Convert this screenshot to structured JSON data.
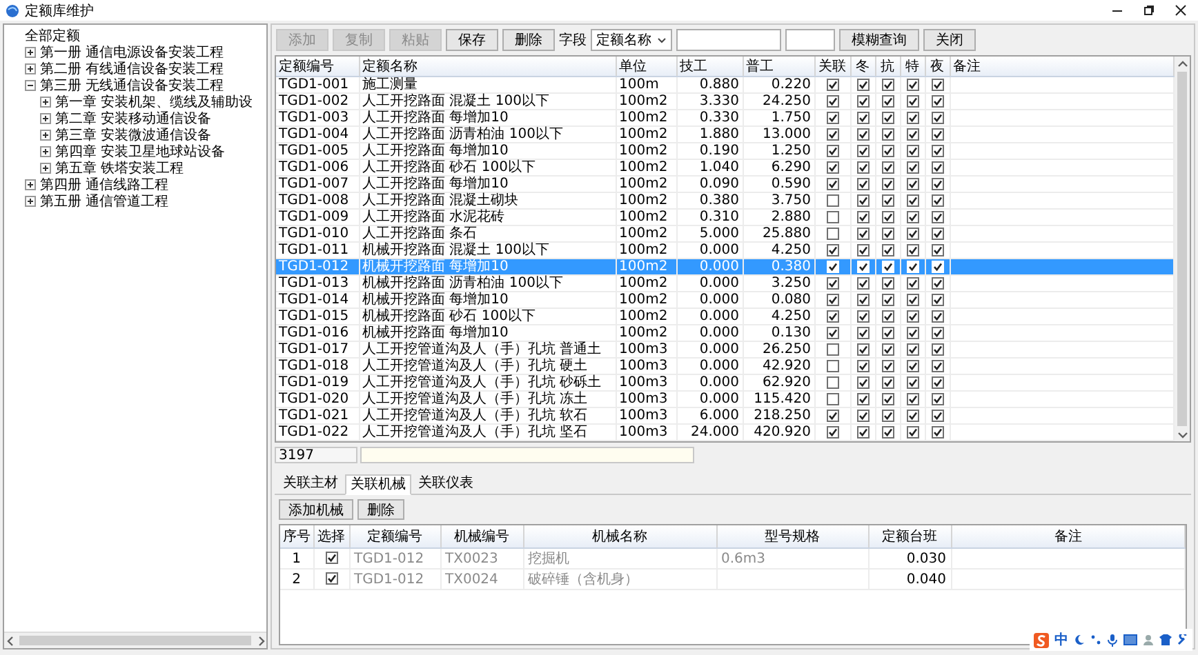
{
  "window": {
    "title": "定额库维护"
  },
  "tree": [
    {
      "label": "全部定额",
      "children": [
        {
          "label": "第一册 通信电源设备安装工程",
          "expanded": false
        },
        {
          "label": "第二册 有线通信设备安装工程",
          "expanded": false
        },
        {
          "label": "第三册 无线通信设备安装工程",
          "expanded": true,
          "children": [
            {
              "label": "第一章 安装机架、缆线及辅助设",
              "expanded": false
            },
            {
              "label": "第二章 安装移动通信设备",
              "expanded": false
            },
            {
              "label": "第三章 安装微波通信设备",
              "expanded": false
            },
            {
              "label": "第四章 安装卫星地球站设备",
              "expanded": false
            },
            {
              "label": "第五章 铁塔安装工程",
              "expanded": false
            }
          ]
        },
        {
          "label": "第四册 通信线路工程",
          "expanded": false
        },
        {
          "label": "第五册 通信管道工程",
          "expanded": false
        }
      ]
    }
  ],
  "toolbar": {
    "buttons": [
      {
        "label": "添加",
        "disabled": true
      },
      {
        "label": "复制",
        "disabled": true
      },
      {
        "label": "粘贴",
        "disabled": true
      },
      {
        "label": "保存",
        "disabled": false
      },
      {
        "label": "删除",
        "disabled": false
      }
    ],
    "field_label": "字段",
    "field_select": "定额名称",
    "search_button": "模糊查询",
    "close_button": "关闭"
  },
  "grid": {
    "columns": [
      "定额编号",
      "定额名称",
      "单位",
      "技工",
      "普工",
      "关联",
      "冬",
      "抗",
      "特",
      "夜",
      "备注"
    ],
    "rows": [
      {
        "code": "TGD1-001",
        "name": "施工测量",
        "unit": "100m",
        "skilled": "0.880",
        "general": "0.220",
        "flags": [
          true,
          true,
          true,
          true,
          true
        ],
        "selected": false
      },
      {
        "code": "TGD1-002",
        "name": "人工开挖路面 混凝土 100以下",
        "unit": "100m2",
        "skilled": "3.330",
        "general": "24.250",
        "flags": [
          true,
          true,
          true,
          true,
          true
        ],
        "selected": false
      },
      {
        "code": "TGD1-003",
        "name": "人工开挖路面 每增加10",
        "unit": "100m2",
        "skilled": "0.330",
        "general": "1.750",
        "flags": [
          true,
          true,
          true,
          true,
          true
        ],
        "selected": false
      },
      {
        "code": "TGD1-004",
        "name": "人工开挖路面 沥青柏油 100以下",
        "unit": "100m2",
        "skilled": "1.880",
        "general": "13.000",
        "flags": [
          true,
          true,
          true,
          true,
          true
        ],
        "selected": false
      },
      {
        "code": "TGD1-005",
        "name": "人工开挖路面 每增加10",
        "unit": "100m2",
        "skilled": "0.190",
        "general": "1.250",
        "flags": [
          true,
          true,
          true,
          true,
          true
        ],
        "selected": false
      },
      {
        "code": "TGD1-006",
        "name": "人工开挖路面 砂石 100以下",
        "unit": "100m2",
        "skilled": "1.040",
        "general": "6.290",
        "flags": [
          true,
          true,
          true,
          true,
          true
        ],
        "selected": false
      },
      {
        "code": "TGD1-007",
        "name": "人工开挖路面 每增加10",
        "unit": "100m2",
        "skilled": "0.090",
        "general": "0.590",
        "flags": [
          true,
          true,
          true,
          true,
          true
        ],
        "selected": false
      },
      {
        "code": "TGD1-008",
        "name": "人工开挖路面 混凝土砌块",
        "unit": "100m2",
        "skilled": "0.380",
        "general": "3.750",
        "flags": [
          false,
          true,
          true,
          true,
          true
        ],
        "selected": false
      },
      {
        "code": "TGD1-009",
        "name": "人工开挖路面 水泥花砖",
        "unit": "100m2",
        "skilled": "0.310",
        "general": "2.880",
        "flags": [
          false,
          true,
          true,
          true,
          true
        ],
        "selected": false
      },
      {
        "code": "TGD1-010",
        "name": "人工开挖路面 条石",
        "unit": "100m2",
        "skilled": "5.000",
        "general": "25.880",
        "flags": [
          false,
          true,
          true,
          true,
          true
        ],
        "selected": false
      },
      {
        "code": "TGD1-011",
        "name": "机械开挖路面 混凝土 100以下",
        "unit": "100m2",
        "skilled": "0.000",
        "general": "4.250",
        "flags": [
          true,
          true,
          true,
          true,
          true
        ],
        "selected": false
      },
      {
        "code": "TGD1-012",
        "name": "机械开挖路面 每增加10",
        "unit": "100m2",
        "skilled": "0.000",
        "general": "0.380",
        "flags": [
          true,
          true,
          true,
          true,
          true
        ],
        "selected": true
      },
      {
        "code": "TGD1-013",
        "name": "机械开挖路面 沥青柏油 100以下",
        "unit": "100m2",
        "skilled": "0.000",
        "general": "3.250",
        "flags": [
          true,
          true,
          true,
          true,
          true
        ],
        "selected": false
      },
      {
        "code": "TGD1-014",
        "name": "机械开挖路面 每增加10",
        "unit": "100m2",
        "skilled": "0.000",
        "general": "0.080",
        "flags": [
          true,
          true,
          true,
          true,
          true
        ],
        "selected": false
      },
      {
        "code": "TGD1-015",
        "name": "机械开挖路面 砂石 100以下",
        "unit": "100m2",
        "skilled": "0.000",
        "general": "4.250",
        "flags": [
          true,
          true,
          true,
          true,
          true
        ],
        "selected": false
      },
      {
        "code": "TGD1-016",
        "name": "机械开挖路面 每增加10",
        "unit": "100m2",
        "skilled": "0.000",
        "general": "0.130",
        "flags": [
          true,
          true,
          true,
          true,
          true
        ],
        "selected": false
      },
      {
        "code": "TGD1-017",
        "name": "人工开挖管道沟及人（手）孔坑 普通土",
        "unit": "100m3",
        "skilled": "0.000",
        "general": "26.250",
        "flags": [
          false,
          true,
          true,
          true,
          true
        ],
        "selected": false
      },
      {
        "code": "TGD1-018",
        "name": "人工开挖管道沟及人（手）孔坑 硬土",
        "unit": "100m3",
        "skilled": "0.000",
        "general": "42.920",
        "flags": [
          false,
          true,
          true,
          true,
          true
        ],
        "selected": false
      },
      {
        "code": "TGD1-019",
        "name": "人工开挖管道沟及人（手）孔坑 砂砾土",
        "unit": "100m3",
        "skilled": "0.000",
        "general": "62.920",
        "flags": [
          false,
          true,
          true,
          true,
          true
        ],
        "selected": false
      },
      {
        "code": "TGD1-020",
        "name": "人工开挖管道沟及人（手）孔坑 冻土",
        "unit": "100m3",
        "skilled": "0.000",
        "general": "115.420",
        "flags": [
          false,
          true,
          true,
          true,
          true
        ],
        "selected": false
      },
      {
        "code": "TGD1-021",
        "name": "人工开挖管道沟及人（手）孔坑 软石",
        "unit": "100m3",
        "skilled": "6.000",
        "general": "218.250",
        "flags": [
          true,
          true,
          true,
          true,
          true
        ],
        "selected": false
      },
      {
        "code": "TGD1-022",
        "name": "人工开挖管道沟及人（手）孔坑 坚石",
        "unit": "100m3",
        "skilled": "24.000",
        "general": "420.920",
        "flags": [
          true,
          true,
          true,
          true,
          true
        ],
        "selected": false
      }
    ]
  },
  "status": {
    "count": "3197"
  },
  "detail_tabs": [
    {
      "label": "关联主材",
      "selected": false
    },
    {
      "label": "关联机械",
      "selected": true
    },
    {
      "label": "关联仪表",
      "selected": false
    }
  ],
  "detail_buttons": [
    "添加机械",
    "删除"
  ],
  "detail_table": {
    "columns": [
      "序号",
      "选择",
      "定额编号",
      "机械编号",
      "机械名称",
      "型号规格",
      "定额台班",
      "备注"
    ],
    "rows": [
      {
        "index": "1",
        "checked": true,
        "code": "TGD1-012",
        "machine_code": "TX0023",
        "machine_name": "挖掘机",
        "spec": "0.6m3",
        "quota": "0.030"
      },
      {
        "index": "2",
        "checked": true,
        "code": "TGD1-012",
        "machine_code": "TX0024",
        "machine_name": "破碎锤（含机身）",
        "quota": "0.040"
      }
    ]
  },
  "ime": {
    "mode": "中"
  }
}
